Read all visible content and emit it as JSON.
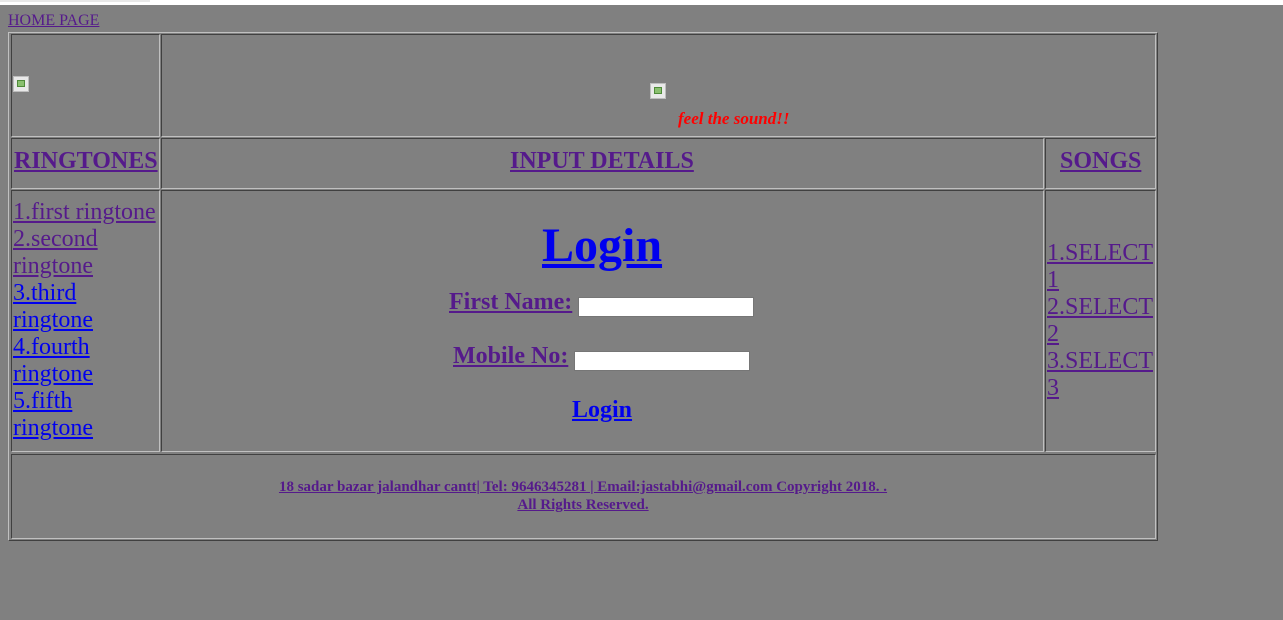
{
  "nav": {
    "home_label": "HOME PAGE"
  },
  "header": {
    "tagline": "feel the sound!!"
  },
  "columns": {
    "ringtones_heading": "RINGTONES",
    "input_heading": "INPUT DETAILS",
    "songs_heading": "SONGS"
  },
  "ringtones": [
    {
      "line1": "1.first ringtone",
      "line2": ""
    },
    {
      "line1": "2.second",
      "line2": "ringtone"
    },
    {
      "line1": "3.third",
      "line2": "ringtone"
    },
    {
      "line1": "4.fourth",
      "line2": "ringtone"
    },
    {
      "line1": "5.fifth",
      "line2": "ringtone"
    }
  ],
  "songs": [
    {
      "line1": "1.SELECT",
      "line2": "1"
    },
    {
      "line1": "2.SELECT",
      "line2": "2"
    },
    {
      "line1": "3.SELECT",
      "line2": "3"
    }
  ],
  "form": {
    "title": "Login",
    "first_name_label": "First Name: ",
    "first_name_value": "",
    "mobile_label": "Mobile No: ",
    "mobile_value": "",
    "submit_label": "Login"
  },
  "footer": {
    "line1": "18 sadar bazar jalandhar cantt| Tel: 9646345281 | Email:jastabhi@gmail.com Copyright 2018. .",
    "line2": "All Rights Reserved."
  },
  "colors": {
    "background": "#808080",
    "visited_link": "#551a8b",
    "link": "#0000ee",
    "tagline": "#ff0000"
  }
}
